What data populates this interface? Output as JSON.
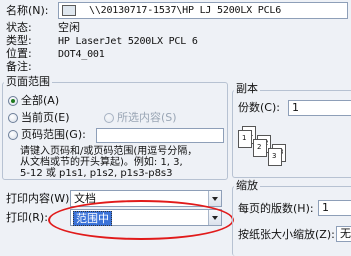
{
  "printer": {
    "name_label": "名称(N):",
    "name_value": "\\\\20130717-1537\\HP LJ 5200LX PCL6",
    "status_label": "状态:",
    "status_value": "空闲",
    "type_label": "类型:",
    "type_value": "HP LaserJet 5200LX PCL 6",
    "where_label": "位置:",
    "where_value": "DOT4_001",
    "comment_label": "备注:"
  },
  "page_range": {
    "title": "页面范围",
    "all": "全部(A)",
    "current": "当前页(E)",
    "selection": "所选内容(S)",
    "pages": "页码范围(G):",
    "hint_line1": "请键入页码和/或页码范围(用逗号分隔，",
    "hint_line2": "从文档或节的开头算起)。例如: 1, 3,",
    "hint_line3": "5-12 或 p1s1, p1s2, p1s3-p8s3"
  },
  "copies": {
    "title": "副本",
    "count_label": "份数(C):",
    "count_value": "1",
    "collate_pages": [
      "1",
      "1",
      "2",
      "2",
      "3",
      "3"
    ]
  },
  "print_what": {
    "label": "打印内容(W):",
    "value": "文档"
  },
  "print": {
    "label": "打印(R):",
    "value": "范围中"
  },
  "zoom": {
    "title": "缩放",
    "pages_per_sheet_label": "每页的版数(H):",
    "pages_per_sheet_value": "1",
    "scale_to_paper_label": "按纸张大小缩放(Z):",
    "scale_to_paper_value": "无"
  },
  "colors": {
    "highlight_ellipse": "#e11a1a",
    "selection_bg": "#3c73d8"
  }
}
